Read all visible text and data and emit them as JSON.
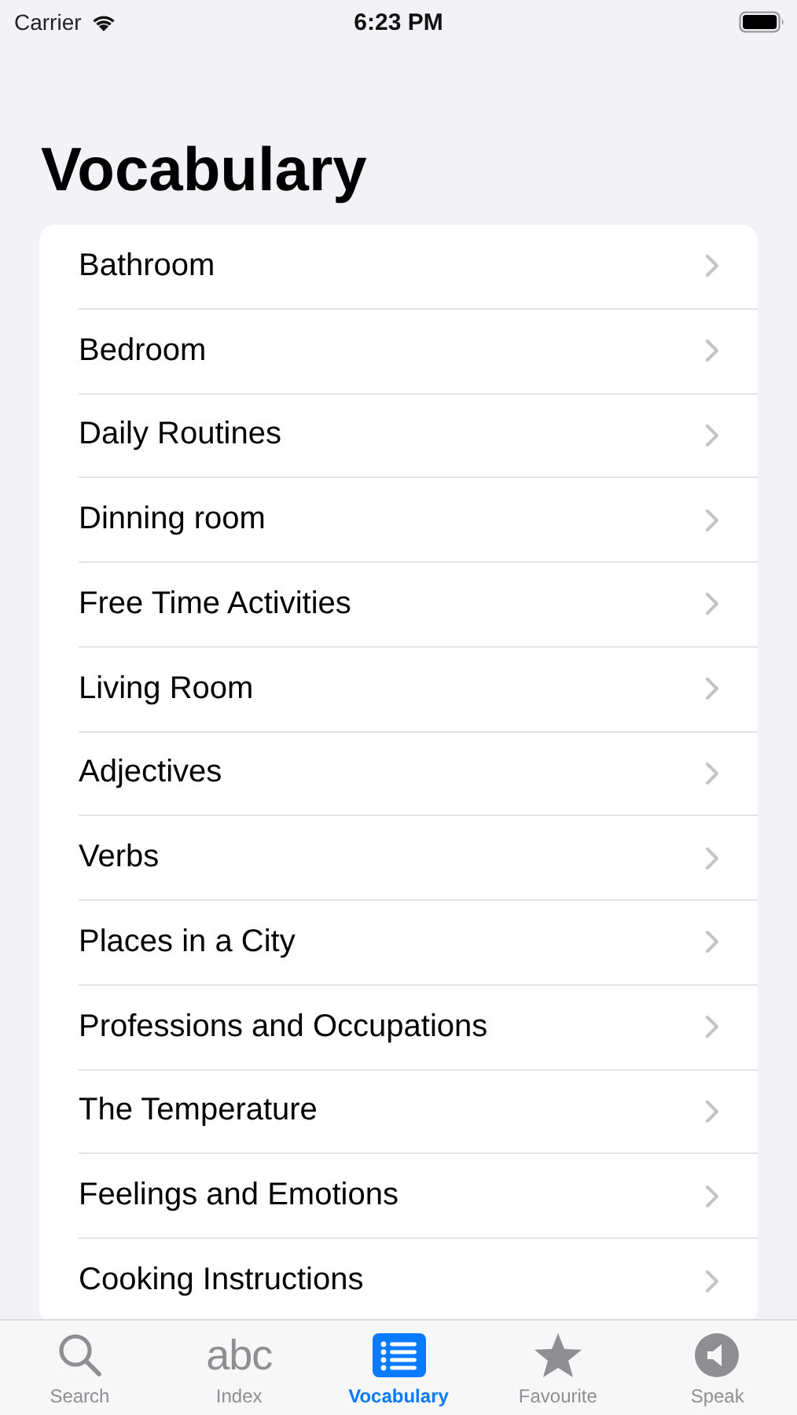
{
  "status_bar": {
    "carrier": "Carrier",
    "time": "6:23 PM"
  },
  "title": "Vocabulary",
  "items": [
    {
      "label": "Bathroom"
    },
    {
      "label": "Bedroom"
    },
    {
      "label": "Daily Routines"
    },
    {
      "label": "Dinning room"
    },
    {
      "label": "Free Time Activities"
    },
    {
      "label": "Living Room"
    },
    {
      "label": "Adjectives"
    },
    {
      "label": "Verbs"
    },
    {
      "label": "Places in a City"
    },
    {
      "label": "Professions and Occupations"
    },
    {
      "label": "The Temperature"
    },
    {
      "label": "Feelings and Emotions"
    },
    {
      "label": "Cooking Instructions"
    }
  ],
  "tabs": [
    {
      "kind": "search",
      "label": "Search",
      "selected": false
    },
    {
      "kind": "text",
      "icon_text": "abc",
      "label": "Index",
      "selected": false
    },
    {
      "kind": "list",
      "label": "Vocabulary",
      "selected": true
    },
    {
      "kind": "star",
      "label": "Favourite",
      "selected": false
    },
    {
      "kind": "speaker",
      "label": "Speak",
      "selected": false
    }
  ]
}
